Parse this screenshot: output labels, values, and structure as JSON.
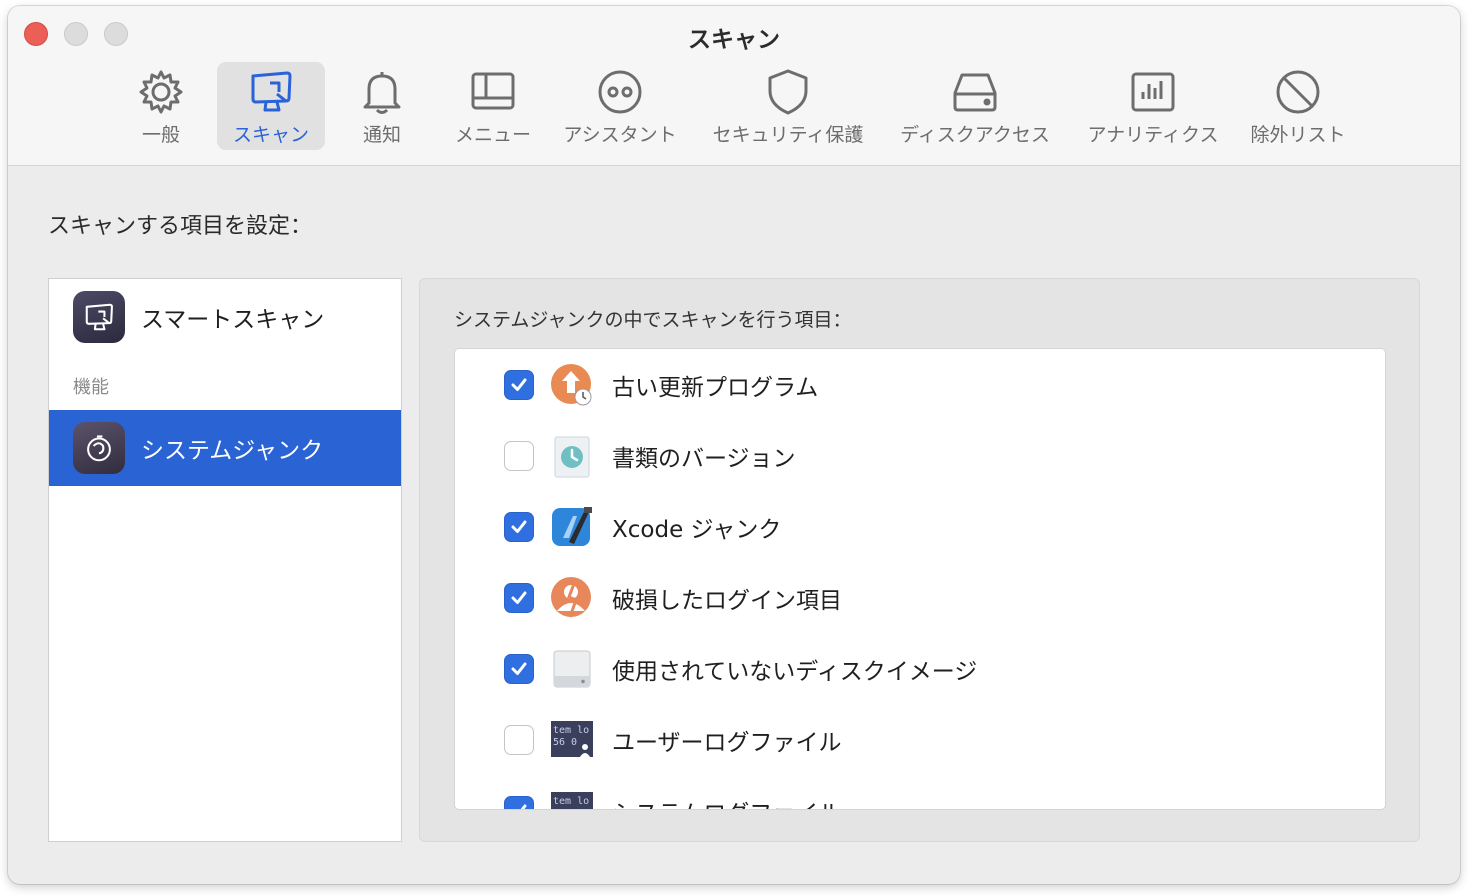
{
  "window": {
    "title": "スキャン"
  },
  "toolbar": {
    "items": [
      {
        "label": "一般",
        "icon": "gear-icon",
        "active": false
      },
      {
        "label": "スキャン",
        "icon": "monitor-scan-icon",
        "active": true
      },
      {
        "label": "通知",
        "icon": "bell-icon",
        "active": false
      },
      {
        "label": "メニュー",
        "icon": "menu-window-icon",
        "active": false
      },
      {
        "label": "アシスタント",
        "icon": "assistant-icon",
        "active": false
      },
      {
        "label": "セキュリティ保護",
        "icon": "shield-icon",
        "active": false
      },
      {
        "label": "ディスクアクセス",
        "icon": "disk-icon",
        "active": false
      },
      {
        "label": "アナリティクス",
        "icon": "analytics-icon",
        "active": false
      },
      {
        "label": "除外リスト",
        "icon": "prohibited-icon",
        "active": false
      }
    ]
  },
  "main": {
    "section_title": "スキャンする項目を設定：",
    "sidebar": {
      "smart_scan": "スマートスキャン",
      "section_label": "機能",
      "selected": "システムジャンク"
    },
    "panel": {
      "title": "システムジャンクの中でスキャンを行う項目：",
      "items": [
        {
          "label": "古い更新プログラム",
          "checked": true,
          "icon": "update-clock-icon"
        },
        {
          "label": "書類のバージョン",
          "checked": false,
          "icon": "document-versions-icon"
        },
        {
          "label": "Xcode ジャンク",
          "checked": true,
          "icon": "xcode-icon"
        },
        {
          "label": "破損したログイン項目",
          "checked": true,
          "icon": "broken-login-icon"
        },
        {
          "label": "使用されていないディスクイメージ",
          "checked": true,
          "icon": "disk-image-icon"
        },
        {
          "label": "ユーザーログファイル",
          "checked": false,
          "icon": "user-log-file-icon"
        },
        {
          "label": "システムログファイル",
          "checked": true,
          "icon": "system-log-file-icon"
        }
      ]
    }
  },
  "colors": {
    "accent": "#2a63d4",
    "toolbar_active": "#2a62d8",
    "close_button": "#ec5f57"
  }
}
